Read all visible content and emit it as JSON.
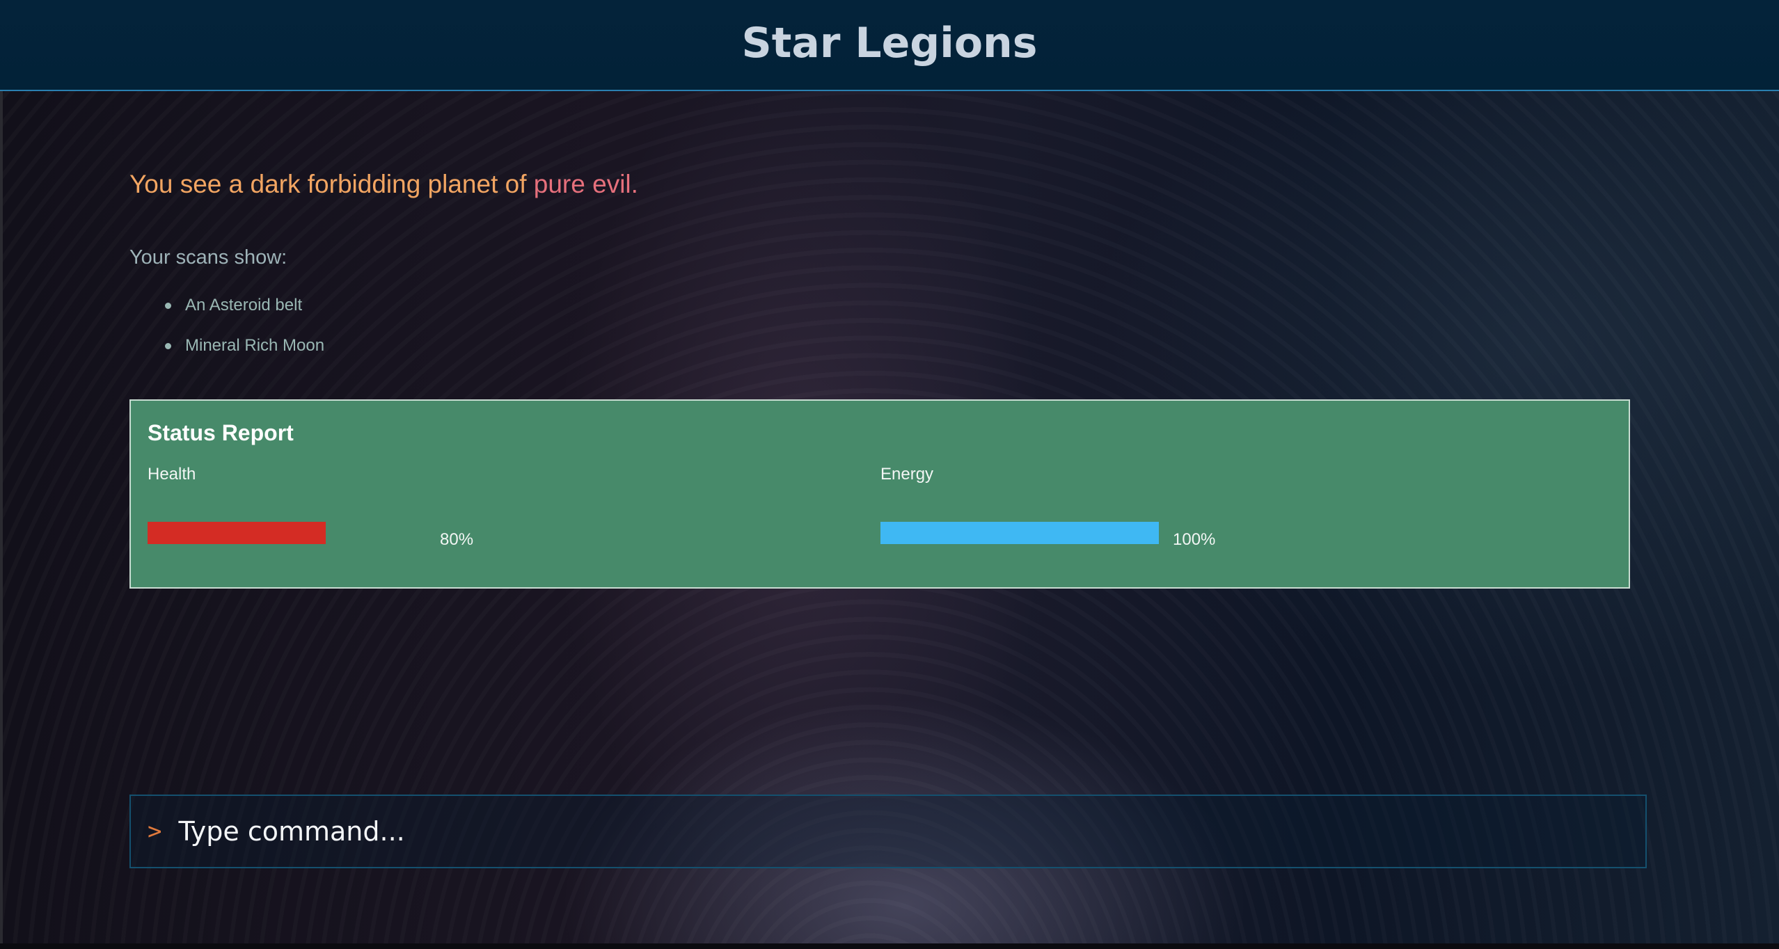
{
  "header": {
    "title": "Star Legions"
  },
  "scene": {
    "intro_text": "You see a dark forbidding planet of ",
    "intro_highlight": "pure evil.",
    "scans_label": "Your scans show:",
    "scan_items": [
      "An Asteroid belt",
      "Mineral Rich Moon"
    ]
  },
  "status_report": {
    "title": "Status Report",
    "health": {
      "label": "Health",
      "value_text": "80%",
      "fraction": 0.8,
      "color": "#d42c24"
    },
    "energy": {
      "label": "Energy",
      "value_text": "100%",
      "fraction": 1.0,
      "color": "#3fb8f3"
    }
  },
  "command": {
    "prompt_symbol": ">",
    "placeholder": "Type command..."
  },
  "colors": {
    "header_bg": "#03243a",
    "intro_text": "#f2a562",
    "intro_highlight": "#e6707c",
    "status_panel": "#478a6a"
  }
}
